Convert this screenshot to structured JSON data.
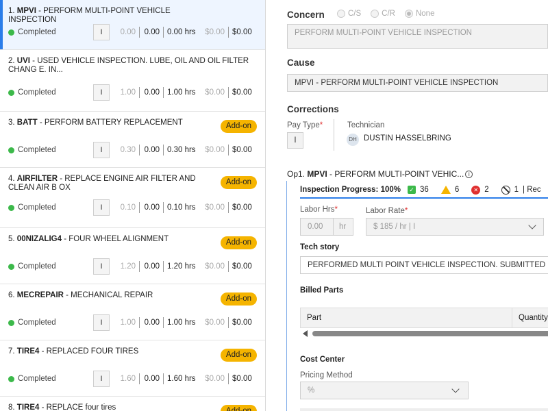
{
  "operations": [
    {
      "num": "1.",
      "code": "MPVI",
      "desc": "- PERFORM MULTI-POINT VEHICLE INSPECTION",
      "status": "Completed",
      "pay": "I",
      "n1": "0.00",
      "n2": "0.00",
      "n3": "0.00 hrs",
      "m1": "$0.00",
      "m2": "$0.00",
      "addon": ""
    },
    {
      "num": "2.",
      "code": "UVI",
      "desc": "- USED VEHICLE INSPECTION. LUBE, OIL AND OIL FILTER CHANG E. IN...",
      "status": "Completed",
      "pay": "I",
      "n1": "1.00",
      "n2": "0.00",
      "n3": "1.00 hrs",
      "m1": "$0.00",
      "m2": "$0.00",
      "addon": ""
    },
    {
      "num": "3.",
      "code": "BATT",
      "desc": "- PERFORM BATTERY REPLACEMENT",
      "status": "Completed",
      "pay": "I",
      "n1": "0.30",
      "n2": "0.00",
      "n3": "0.30 hrs",
      "m1": "$0.00",
      "m2": "$0.00",
      "addon": "Add-on"
    },
    {
      "num": "4.",
      "code": "AIRFILTER",
      "desc": "- REPLACE ENGINE AIR FILTER AND CLEAN AIR B OX",
      "status": "Completed",
      "pay": "I",
      "n1": "0.10",
      "n2": "0.00",
      "n3": "0.10 hrs",
      "m1": "$0.00",
      "m2": "$0.00",
      "addon": "Add-on"
    },
    {
      "num": "5.",
      "code": "00NIZALIG4",
      "desc": "- FOUR WHEEL ALIGNMENT",
      "status": "Completed",
      "pay": "I",
      "n1": "1.20",
      "n2": "0.00",
      "n3": "1.20 hrs",
      "m1": "$0.00",
      "m2": "$0.00",
      "addon": "Add-on"
    },
    {
      "num": "6.",
      "code": "MECREPAIR",
      "desc": "- MECHANICAL REPAIR",
      "status": "Completed",
      "pay": "I",
      "n1": "1.00",
      "n2": "0.00",
      "n3": "1.00 hrs",
      "m1": "$0.00",
      "m2": "$0.00",
      "addon": "Add-on"
    },
    {
      "num": "7.",
      "code": "TIRE4",
      "desc": "- REPLACED FOUR TIRES",
      "status": "Completed",
      "pay": "I",
      "n1": "1.60",
      "n2": "0.00",
      "n3": "1.60 hrs",
      "m1": "$0.00",
      "m2": "$0.00",
      "addon": "Add-on"
    },
    {
      "num": "8.",
      "code": "TIRE4",
      "desc": "- REPLACE four tires",
      "status": "",
      "pay": "",
      "n1": "",
      "n2": "",
      "n3": "",
      "m1": "",
      "m2": "",
      "addon": "Add-on"
    }
  ],
  "detail": {
    "concern_label": "Concern",
    "radio_cs": "C/S",
    "radio_cr": "C/R",
    "radio_none": "None",
    "concern_value": "PERFORM MULTI-POINT VEHICLE INSPECTION",
    "cause_label": "Cause",
    "cause_value": "MPVI - PERFORM MULTI-POINT VEHICLE INSPECTION",
    "corrections_label": "Corrections",
    "pay_type_label": "Pay Type",
    "pay_type_value": "I",
    "technician_label": "Technician",
    "tech_initials": "DH",
    "tech_name": "DUSTIN HASSELBRING",
    "op_prefix": "Op1.",
    "op_code": "MPVI",
    "op_desc": "- PERFORM MULTI-POINT VEHIC...",
    "progress_label": "Inspection Progress:",
    "progress_value": "100%",
    "count_ok": "36",
    "count_warn": "6",
    "count_bad": "2",
    "count_na": "1",
    "progress_tail": "| Rec",
    "labor_hrs_label": "Labor Hrs",
    "labor_hrs_value": "0.00",
    "labor_hrs_unit": "hr",
    "labor_rate_label": "Labor Rate",
    "labor_rate_value": "$ 185 / hr | I",
    "tech_story_label": "Tech story",
    "tech_story_value": "PERFORMED MULTI POINT VEHICLE INSPECTION. SUBMITTED INSPEC",
    "billed_parts_label": "Billed Parts",
    "col_part": "Part",
    "col_quantity": "Quantity",
    "cost_center_label": "Cost Center",
    "pricing_method_label": "Pricing Method",
    "pricing_method_value": "%"
  }
}
